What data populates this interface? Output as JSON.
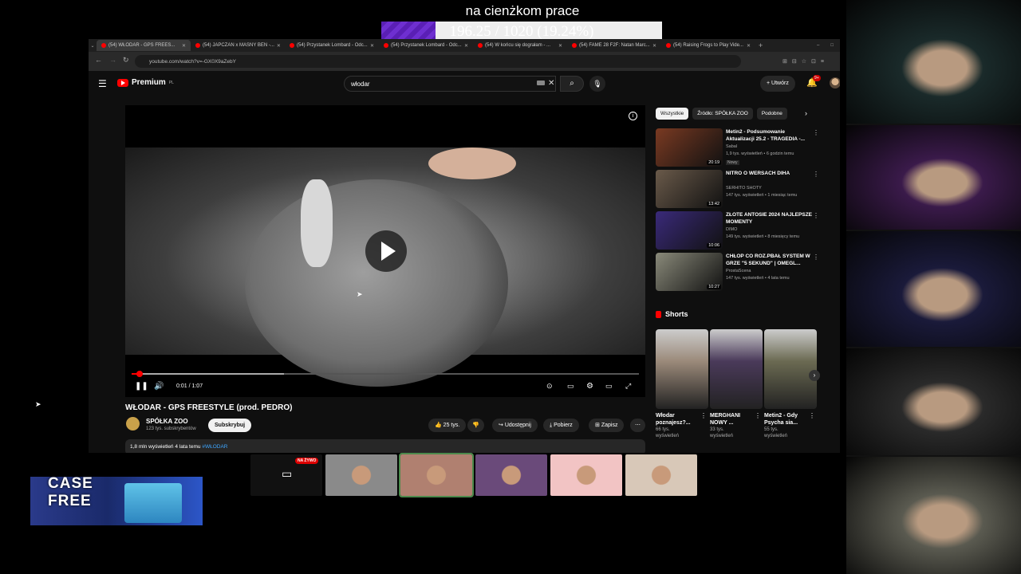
{
  "overlay": {
    "title": "na cienżkom prace",
    "progress_text": "196.25 / 1020 (19.24%)",
    "progress_value": 0.1924
  },
  "browser": {
    "tabs": [
      {
        "label": "(54) WŁODAR - GPS FREES..."
      },
      {
        "label": "(54) JAPCZAN x MASNY BEN -..."
      },
      {
        "label": "(54) Przystanek Lombard - Odc..."
      },
      {
        "label": "(54) Przystanek Lombard - Odc..."
      },
      {
        "label": "(54) W końcu się dograłam - ..."
      },
      {
        "label": "(54) FAME 28 F2F: Natan Marc..."
      },
      {
        "label": "(54) Raising Frogs to Play Vide..."
      }
    ],
    "url": "youtube.com/watch?v=-GX0X9aZebY"
  },
  "youtube": {
    "premium_label": "Premium",
    "premium_region": "PL",
    "search_value": "włodar",
    "create_label": "Utwórz",
    "bell_badge": "9+",
    "player": {
      "time": "0:01 / 1:07",
      "played_fraction": 0.015,
      "buffered_fraction": 0.3
    },
    "video": {
      "title": "WŁODAR - GPS FREESTYLE (prod. PEDRO)",
      "channel": "SPÓŁKA ZOO",
      "subs": "123 tys. subskrybentów",
      "subscribe_label": "Subskrybuj",
      "likes": "25 tys.",
      "share_label": "Udostępnij",
      "download_label": "Pobierz",
      "save_label": "Zapisz",
      "views_line": "1,8 mln wyświetleń  4 lata temu",
      "hashtag": "#WŁODAR"
    },
    "chips": [
      "Wszystkie",
      "Źródło: SPÓŁKA ZOO",
      "Podobne"
    ],
    "recommendations": [
      {
        "title": "Metin2 - Podsumowanie Aktualizacji 25.2 - TRAGEDIA -...",
        "channel": "Sabal",
        "meta": "1,9 tys. wyświetleń • 6 godzin temu",
        "badge": "Nowy",
        "duration": "20:19",
        "thumb_color": "#7a3a22"
      },
      {
        "title": "NITRO O WERSACH DIHA",
        "channel": "SERHITO SHOTY",
        "meta": "147 tys. wyświetleń • 1 miesiąc temu",
        "badge": "",
        "duration": "13:42",
        "thumb_color": "#6a5a4a"
      },
      {
        "title": "ZŁOTE ANTOSIE 2024 NAJLEPSZE MOMENTY",
        "channel": "DIMO",
        "meta": "149 tys. wyświetleń • 8 miesięcy temu",
        "badge": "",
        "duration": "10:06",
        "thumb_color": "#3a2a7a"
      },
      {
        "title": "CHŁOP CO ROZ.PBAŁ SYSTEM W GRZE \"5 SEKUND\" | OMEGL...",
        "channel": "ProstaScena",
        "meta": "147 tys. wyświetleń • 4 lata temu",
        "badge": "",
        "duration": "10:27",
        "thumb_color": "#8a8a7a"
      }
    ],
    "shorts_title": "Shorts",
    "shorts": [
      {
        "title": "Włodar poznajesz?...",
        "views_a": "66 tys.",
        "views_b": "wyświetleń",
        "color": "#9b8a7a"
      },
      {
        "title": "MERGHANI NOWY ...",
        "views_a": "33 tys.",
        "views_b": "wyświetleń",
        "color": "#4a3a5a"
      },
      {
        "title": "Metin2 - Gdy Psycha sia...",
        "views_a": "55 tys.",
        "views_b": "wyświetleń",
        "color": "#6b6a52"
      }
    ]
  },
  "stream": {
    "live_badge": "NA ŻYWO",
    "promo_text_1": "CASE",
    "promo_text_2": "FREE",
    "bottom_tiles": [
      "#111111",
      "#8a8a8a",
      "#b08070",
      "#6a4a7a",
      "#f2c4c4",
      "#d8c8b8"
    ],
    "cam_colors": [
      "#1a2a2a",
      "#3a1a4a",
      "#1a1a3a",
      "#2a2a2a",
      "#5a5a50"
    ]
  }
}
